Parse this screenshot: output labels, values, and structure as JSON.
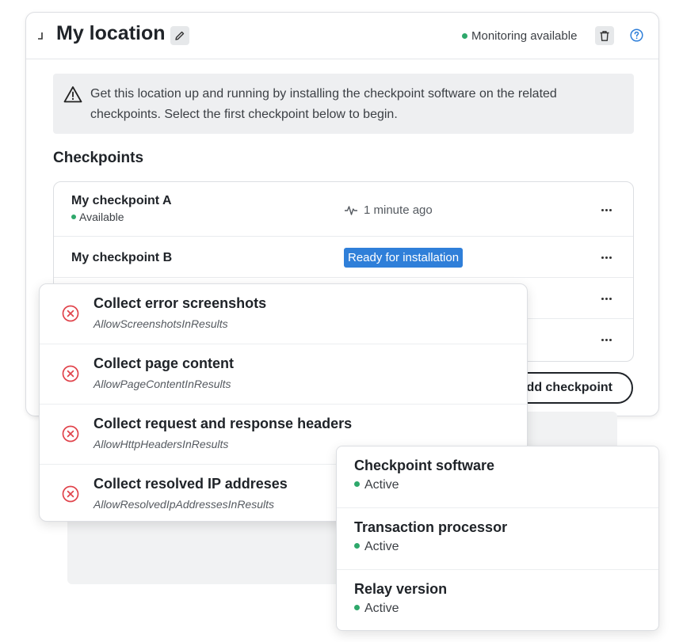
{
  "location": {
    "title": "My location",
    "monitoring_status": "Monitoring available",
    "alert_text": "Get this location up and running by installing the checkpoint software on the related checkpoints. Select the first checkpoint below to begin.",
    "section_title": "Checkpoints",
    "checkpoints": [
      {
        "name": "My checkpoint A",
        "status": "Available",
        "last_seen": "1 minute ago"
      },
      {
        "name": "My checkpoint B",
        "badge": "Ready for installation"
      }
    ],
    "add_button_label": "Add checkpoint"
  },
  "settings": [
    {
      "title": "Collect error screenshots",
      "key": "AllowScreenshotsInResults"
    },
    {
      "title": "Collect page content",
      "key": "AllowPageContentInResults"
    },
    {
      "title": "Collect request and response headers",
      "key": "AllowHttpHeadersInResults"
    },
    {
      "title": "Collect resolved IP addreses",
      "key": "AllowResolvedIpAddressesInResults"
    }
  ],
  "components": [
    {
      "title": "Checkpoint software",
      "status": "Active"
    },
    {
      "title": "Transaction processor",
      "status": "Active"
    },
    {
      "title": "Relay version",
      "status": "Active"
    }
  ],
  "colors": {
    "accent": "#2f7fd9",
    "status_ok": "#2ea86b",
    "error": "#e0434b"
  },
  "icons": [
    "collapse-icon",
    "pencil-icon",
    "trash-icon",
    "help-icon",
    "warning-icon",
    "pulse-icon",
    "more-icon",
    "error-circle-icon"
  ]
}
